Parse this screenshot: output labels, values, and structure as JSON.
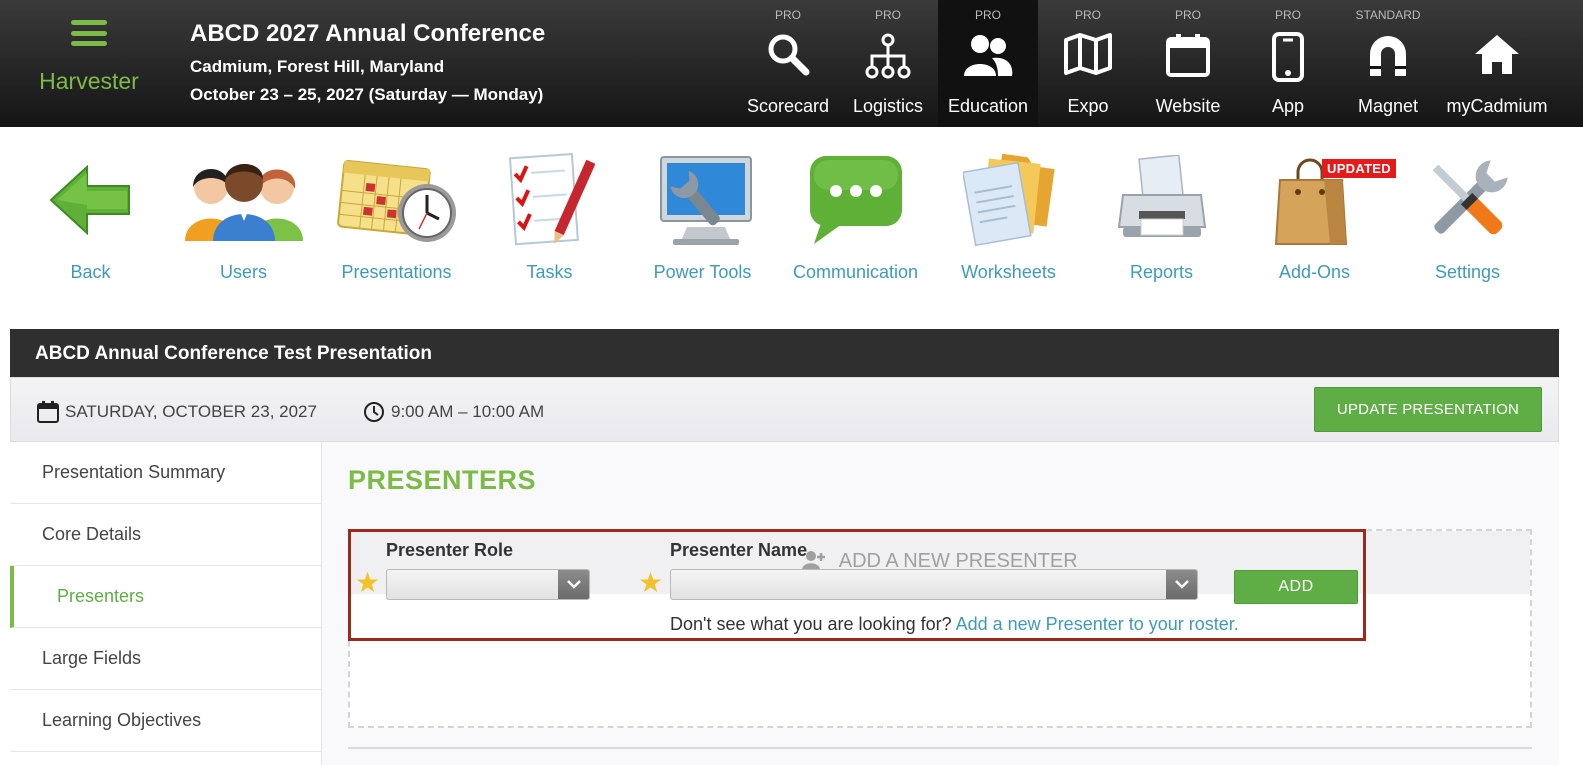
{
  "brand": {
    "name": "Harvester",
    "menu_icon": "hamburger-menu-icon"
  },
  "conference": {
    "title": "ABCD 2027 Annual Conference",
    "location": "Cadmium, Forest Hill, Maryland",
    "dates": "October 23 – 25, 2027 (Saturday — Monday)"
  },
  "modules": [
    {
      "tier": "PRO",
      "label": "Scorecard",
      "icon": "search-icon"
    },
    {
      "tier": "PRO",
      "label": "Logistics",
      "icon": "hierarchy-icon"
    },
    {
      "tier": "PRO",
      "label": "Education",
      "icon": "users-icon",
      "active": true
    },
    {
      "tier": "PRO",
      "label": "Expo",
      "icon": "map-icon"
    },
    {
      "tier": "PRO",
      "label": "Website",
      "icon": "calendar-icon"
    },
    {
      "tier": "PRO",
      "label": "App",
      "icon": "phone-icon"
    },
    {
      "tier": "STANDARD",
      "label": "Magnet",
      "icon": "magnet-icon"
    },
    {
      "tier": "",
      "label": "myCadmium",
      "icon": "home-icon"
    }
  ],
  "toolbar": [
    {
      "label": "Back",
      "icon": "back-arrow-icon"
    },
    {
      "label": "Users",
      "icon": "users-group-icon"
    },
    {
      "label": "Presentations",
      "icon": "calendar-clock-icon"
    },
    {
      "label": "Tasks",
      "icon": "checklist-icon"
    },
    {
      "label": "Power Tools",
      "icon": "monitor-wrench-icon"
    },
    {
      "label": "Communication",
      "icon": "chat-bubble-icon"
    },
    {
      "label": "Worksheets",
      "icon": "folder-documents-icon"
    },
    {
      "label": "Reports",
      "icon": "printer-icon"
    },
    {
      "label": "Add-Ons",
      "icon": "shopping-bag-icon",
      "badge": "UPDATED"
    },
    {
      "label": "Settings",
      "icon": "tools-icon"
    }
  ],
  "presentation": {
    "title": "ABCD Annual Conference Test Presentation",
    "date": "SATURDAY, OCTOBER 23, 2027",
    "time": "9:00 AM – 10:00 AM",
    "update_label": "UPDATE PRESENTATION"
  },
  "sidenav": [
    {
      "label": "Presentation Summary"
    },
    {
      "label": "Core Details"
    },
    {
      "label": "Presenters",
      "active": true
    },
    {
      "label": "Large Fields"
    },
    {
      "label": "Learning Objectives"
    }
  ],
  "presenters": {
    "heading": "PRESENTERS",
    "add_new_label": "ADD A NEW PRESENTER",
    "role_label": "Presenter Role",
    "role_value": "",
    "name_label": "Presenter Name",
    "name_value": "",
    "add_button": "ADD",
    "hint_text": "Don't see what you are looking for?",
    "hint_link": "Add a new Presenter to your roster."
  },
  "colors": {
    "accent_green": "#7dbb48",
    "link_blue": "#3e9bb8",
    "highlight_red": "#9b2a1d",
    "badge_red": "#e31b1b"
  }
}
